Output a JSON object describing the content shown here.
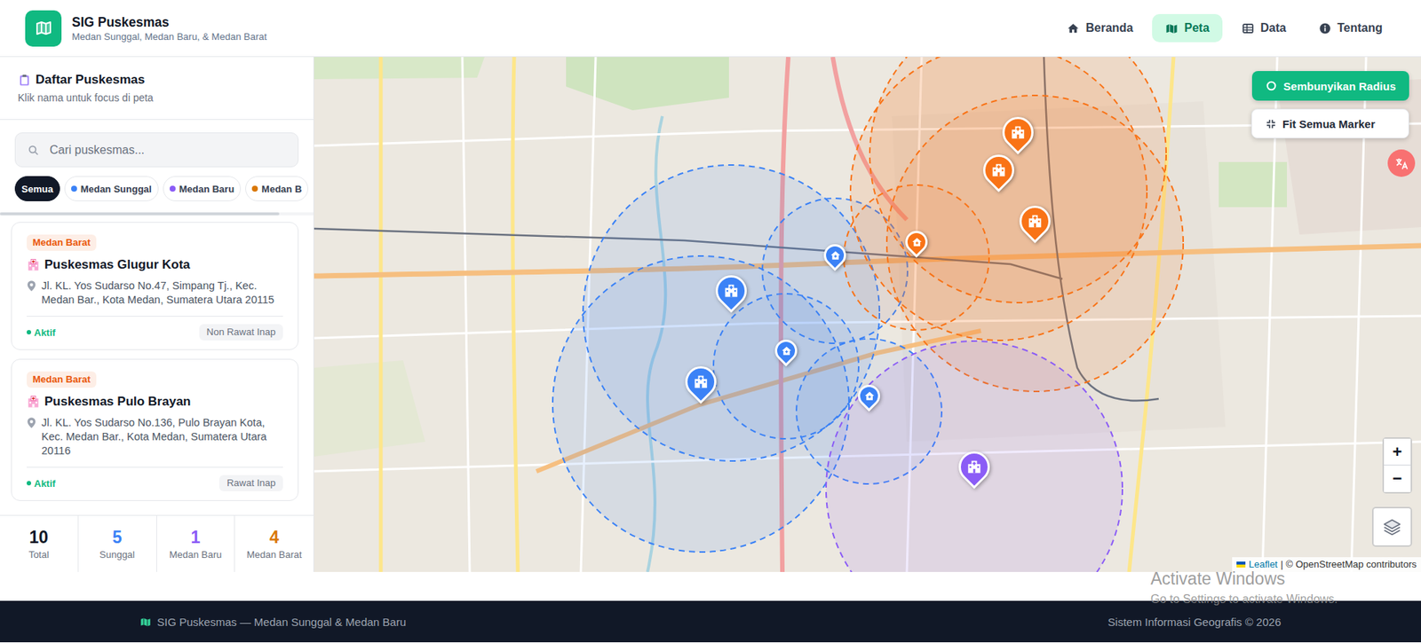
{
  "app": {
    "title": "SIG Puskesmas",
    "subtitle": "Medan Sunggal, Medan Baru, & Medan Barat"
  },
  "nav": [
    {
      "label": "Beranda",
      "selected": false
    },
    {
      "label": "Peta",
      "selected": true
    },
    {
      "label": "Data",
      "selected": false
    },
    {
      "label": "Tentang",
      "selected": false
    }
  ],
  "sidebar": {
    "title": "Daftar Puskesmas",
    "hint": "Klik nama untuk focus di peta",
    "search": {
      "placeholder": "Cari puskesmas..."
    },
    "filters": [
      {
        "label": "Semua",
        "selected": true
      },
      {
        "label": "Medan Sunggal",
        "selected": false,
        "color": "#3b82f6"
      },
      {
        "label": "Medan Baru",
        "selected": false,
        "color": "#8b5cf6"
      },
      {
        "label": "Medan B",
        "selected": false,
        "color": "#d97706"
      }
    ],
    "items": [
      {
        "district": "Medan Barat",
        "color": "#ea580c",
        "name": "Puskesmas Glugur Kota",
        "address": "Jl. KL. Yos Sudarso No.47, Simpang Tj., Kec. Medan Bar., Kota Medan, Sumatera Utara 20115",
        "status": "Aktif",
        "active": true,
        "type": "Non Rawat Inap"
      },
      {
        "district": "Medan Barat",
        "color": "#ea580c",
        "name": "Puskesmas Pulo Brayan",
        "address": "Jl. KL. Yos Sudarso No.136, Pulo Brayan Kota, Kec. Medan Bar., Kota Medan, Sumatera Utara 20116",
        "status": "Aktif",
        "active": true,
        "type": "Rawat Inap"
      }
    ],
    "stats": [
      {
        "value": "10",
        "label": "Total",
        "color": "#111827"
      },
      {
        "value": "5",
        "label": "Sunggal",
        "color": "#3b82f6"
      },
      {
        "value": "1",
        "label": "Medan Baru",
        "color": "#8b5cf6"
      },
      {
        "value": "4",
        "label": "Medan Barat",
        "color": "#d97706"
      }
    ]
  },
  "map": {
    "radius_visible": true,
    "radius_button": "Sembunyikan Radius",
    "fit_button": "Fit Semua Marker",
    "zoom_in": "+",
    "zoom_out": "−",
    "attribution": {
      "link": "Leaflet",
      "text": "| © OpenStreetMap contributors"
    },
    "markers": [
      {
        "kind": "hospital",
        "color": "#3b82f6"
      },
      {
        "kind": "hospital",
        "color": "#3b82f6"
      },
      {
        "kind": "clinic",
        "color": "#3b82f6"
      },
      {
        "kind": "clinic",
        "color": "#3b82f6"
      },
      {
        "kind": "clinic",
        "color": "#3b82f6"
      },
      {
        "kind": "hospital",
        "color": "#f97316"
      },
      {
        "kind": "hospital",
        "color": "#f97316"
      },
      {
        "kind": "hospital",
        "color": "#f97316"
      },
      {
        "kind": "clinic",
        "color": "#f97316"
      },
      {
        "kind": "hospital",
        "color": "#8b5cf6"
      }
    ]
  },
  "footer": {
    "left": "SIG Puskesmas — Medan Sunggal & Medan Baru",
    "right": "Sistem Informasi Geografis © 2026"
  },
  "watermark": {
    "title": "Activate Windows",
    "text": "Go to Settings to activate Windows."
  }
}
